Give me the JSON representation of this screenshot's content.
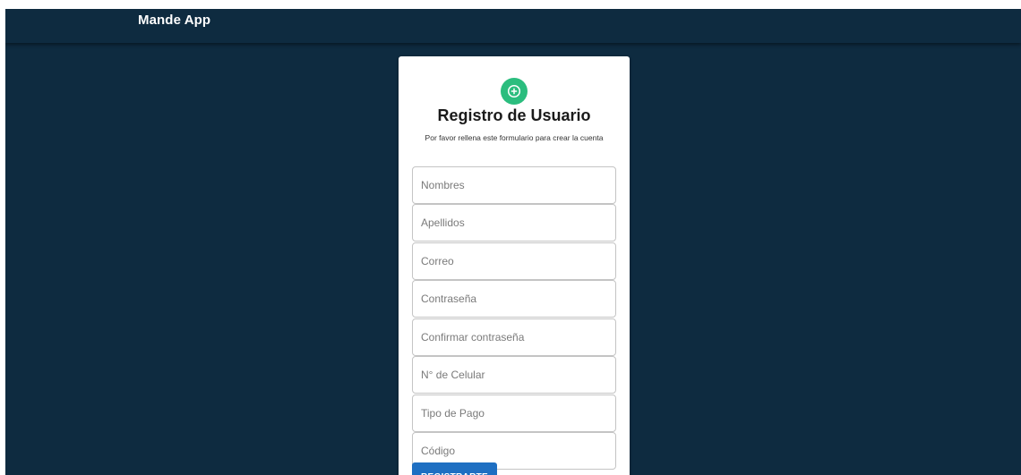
{
  "app": {
    "title": "Mande App"
  },
  "form": {
    "icon": "add-circle-icon",
    "title": "Registro de Usuario",
    "subtitle": "Por favor rellena este formulario para crear la cuenta",
    "fields": [
      {
        "name": "nombres",
        "placeholder": "Nombres",
        "value": ""
      },
      {
        "name": "apellidos",
        "placeholder": "Apellidos",
        "value": ""
      },
      {
        "name": "correo",
        "placeholder": "Correo",
        "value": ""
      },
      {
        "name": "contrasena",
        "placeholder": "Contraseña",
        "value": ""
      },
      {
        "name": "confirmar-contrasena",
        "placeholder": "Confirmar contraseña",
        "value": ""
      },
      {
        "name": "celular",
        "placeholder": "N° de Celular",
        "value": ""
      },
      {
        "name": "tipo-pago",
        "placeholder": "Tipo de Pago",
        "value": ""
      },
      {
        "name": "codigo",
        "placeholder": "Código",
        "value": ""
      }
    ],
    "submit_label": "REGISTRARTE"
  },
  "colors": {
    "background": "#0e2b40",
    "appbar": "#0e2b40",
    "avatar": "#2bbd7e",
    "button": "#1e6fc2"
  }
}
